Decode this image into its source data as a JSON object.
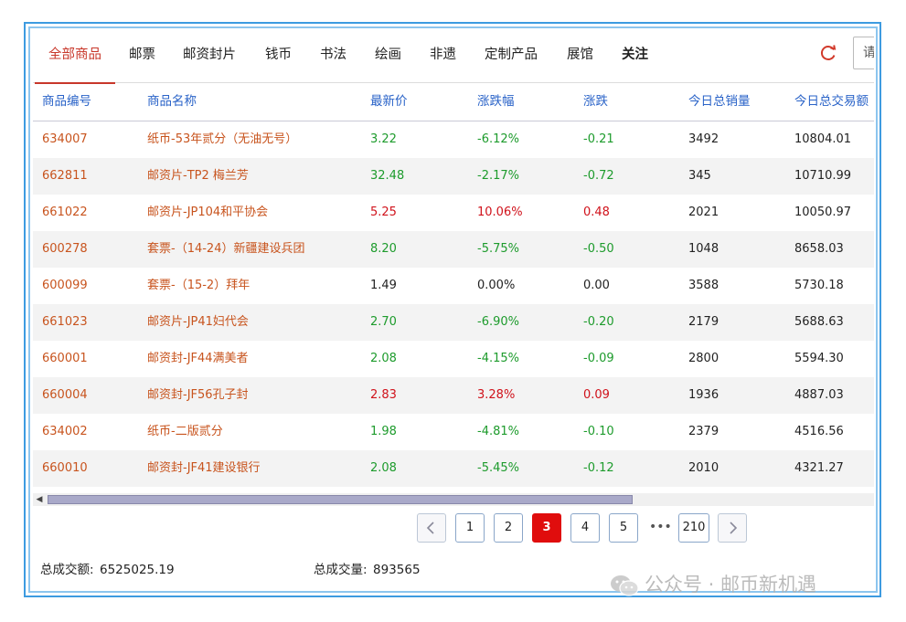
{
  "tabs": [
    {
      "label": "全部商品",
      "active": true
    },
    {
      "label": "邮票"
    },
    {
      "label": "邮资封片"
    },
    {
      "label": "钱币"
    },
    {
      "label": "书法"
    },
    {
      "label": "绘画"
    },
    {
      "label": "非遗"
    },
    {
      "label": "定制产品"
    },
    {
      "label": "展馆"
    },
    {
      "label": "关注",
      "bold": true
    }
  ],
  "toolbar": {
    "refresh_icon": "refresh-icon",
    "search_text": "请"
  },
  "table": {
    "columns": [
      "商品编号",
      "商品名称",
      "最新价",
      "涨跌幅",
      "涨跌",
      "今日总销量",
      "今日总交易额"
    ],
    "rows": [
      {
        "code": "634007",
        "name": "纸币-53年贰分（无油无号）",
        "price": "3.22",
        "pct": "-6.12%",
        "chg": "-0.21",
        "volume": "3492",
        "amount": "10804.01",
        "trend": "down"
      },
      {
        "code": "662811",
        "name": "邮资片-TP2 梅兰芳",
        "price": "32.48",
        "pct": "-2.17%",
        "chg": "-0.72",
        "volume": "345",
        "amount": "10710.99",
        "trend": "down"
      },
      {
        "code": "661022",
        "name": "邮资片-JP104和平协会",
        "price": "5.25",
        "pct": "10.06%",
        "chg": "0.48",
        "volume": "2021",
        "amount": "10050.97",
        "trend": "up"
      },
      {
        "code": "600278",
        "name": "套票-（14-24）新疆建设兵团",
        "price": "8.20",
        "pct": "-5.75%",
        "chg": "-0.50",
        "volume": "1048",
        "amount": "8658.03",
        "trend": "down"
      },
      {
        "code": "600099",
        "name": "套票-（15-2）拜年",
        "price": "1.49",
        "pct": "0.00%",
        "chg": "0.00",
        "volume": "3588",
        "amount": "5730.18",
        "trend": "flat"
      },
      {
        "code": "661023",
        "name": "邮资片-JP41妇代会",
        "price": "2.70",
        "pct": "-6.90%",
        "chg": "-0.20",
        "volume": "2179",
        "amount": "5688.63",
        "trend": "down"
      },
      {
        "code": "660001",
        "name": "邮资封-JF44满美者",
        "price": "2.08",
        "pct": "-4.15%",
        "chg": "-0.09",
        "volume": "2800",
        "amount": "5594.30",
        "trend": "down"
      },
      {
        "code": "660004",
        "name": "邮资封-JF56孔子封",
        "price": "2.83",
        "pct": "3.28%",
        "chg": "0.09",
        "volume": "1936",
        "amount": "4887.03",
        "trend": "up"
      },
      {
        "code": "634002",
        "name": "纸币-二版贰分",
        "price": "1.98",
        "pct": "-4.81%",
        "chg": "-0.10",
        "volume": "2379",
        "amount": "4516.56",
        "trend": "down"
      },
      {
        "code": "660010",
        "name": "邮资封-JF41建设银行",
        "price": "2.08",
        "pct": "-5.45%",
        "chg": "-0.12",
        "volume": "2010",
        "amount": "4321.27",
        "trend": "down"
      }
    ]
  },
  "pagination": {
    "prev_icon": "chevron-left-icon",
    "next_icon": "chevron-right-icon",
    "pages": [
      "1",
      "2",
      "3",
      "4",
      "5"
    ],
    "current": "3",
    "ellipsis": "•••",
    "last": "210"
  },
  "footer": {
    "total_amount_label": "总成交额:",
    "total_amount": "6525025.19",
    "total_volume_label": "总成交量:",
    "total_volume": "893565"
  },
  "watermark": {
    "text": "公众号 · 邮币新机遇",
    "icon": "wechat-icon"
  },
  "colors": {
    "up": "#d0121b",
    "down": "#1d9b2c",
    "accent": "#c8372a",
    "header": "#2a63c8",
    "current_page": "#e00d0d",
    "frame": "#3d9be0"
  }
}
